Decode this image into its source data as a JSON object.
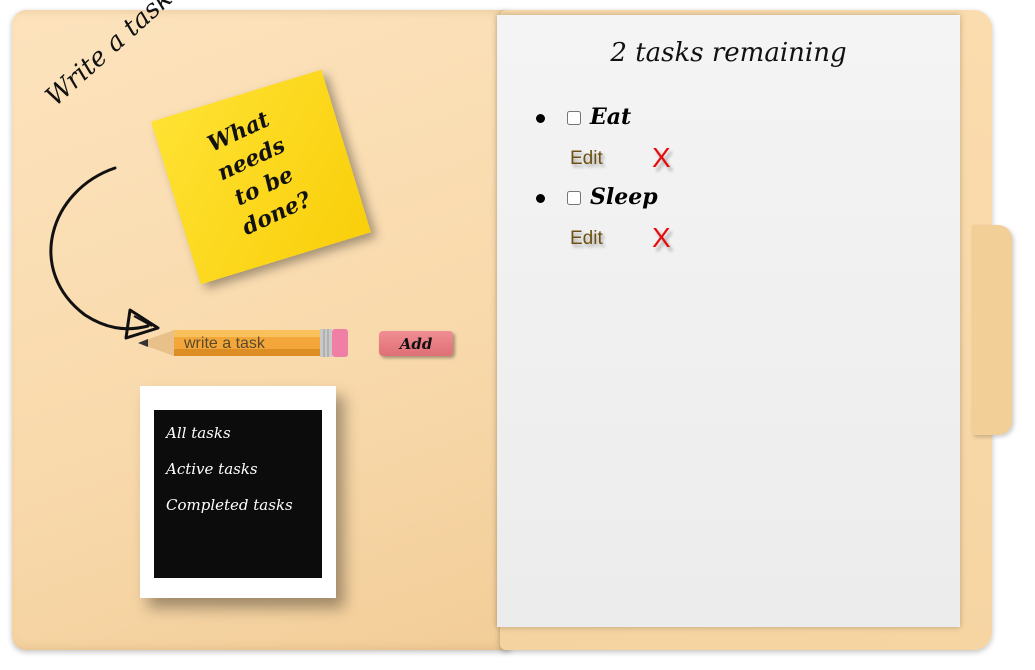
{
  "left_panel": {
    "write_label": "Write a task",
    "sticky_note": "What\nneeds\nto be\ndone?",
    "input_placeholder": "write a task",
    "add_label": "Add",
    "filters": [
      "All tasks",
      "Active tasks",
      "Completed tasks"
    ]
  },
  "right_panel": {
    "remaining": "2 tasks remaining",
    "tasks": [
      {
        "name": "Eat",
        "checked": false,
        "edit_label": "Edit",
        "delete_label": "X"
      },
      {
        "name": "Sleep",
        "checked": false,
        "edit_label": "Edit",
        "delete_label": "X"
      }
    ]
  },
  "colors": {
    "folder": "#f8d9ab",
    "sticky": "#f9d40f",
    "eraser": "#e57d83",
    "edit": "#6b5212",
    "delete": "#e50d0d"
  },
  "icons": [
    "hand-drawn-arrow-icon",
    "pencil-icon",
    "bullet-icon",
    "checkbox-icon"
  ]
}
